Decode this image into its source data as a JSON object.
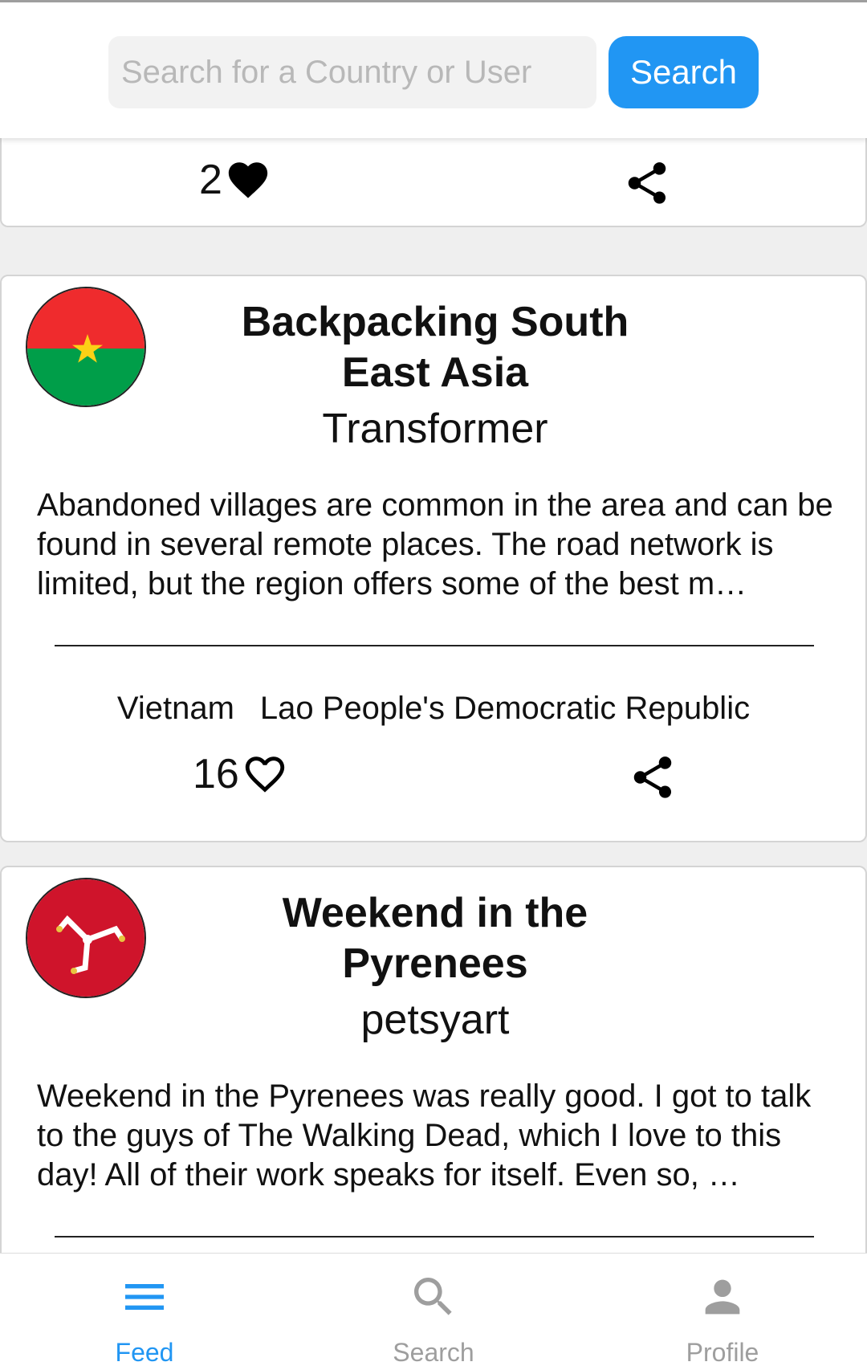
{
  "header": {
    "search_placeholder": "Search for a Country or User",
    "search_button": "Search"
  },
  "feed": {
    "partial_post": {
      "likes": "2",
      "liked": true
    },
    "posts": [
      {
        "flag": "burkina-faso-flag",
        "title_line1": "Backpacking South",
        "title_line2": "East Asia",
        "author": "Transformer",
        "body": "Abandoned villages are common in the area and can be found in several remote places. The road network is limited, but the region offers some of the best m…",
        "countries": [
          "Vietnam",
          "Lao People's Democratic Republic"
        ],
        "likes": "16",
        "liked": false
      },
      {
        "flag": "isle-of-man-flag",
        "title_line1": "Weekend in the",
        "title_line2": "Pyrenees",
        "author": "petsyart",
        "body": "Weekend in the Pyrenees was really good. I got to talk to the guys of The Walking Dead, which I love to this day! All of their work speaks for itself. Even so, …"
      }
    ]
  },
  "bottom_nav": {
    "items": [
      {
        "label": "Feed",
        "icon": "menu-icon",
        "active": true
      },
      {
        "label": "Search",
        "icon": "search-icon",
        "active": false
      },
      {
        "label": "Profile",
        "icon": "person-icon",
        "active": false
      }
    ]
  },
  "colors": {
    "accent": "#2196f3",
    "inactive": "#9e9e9e",
    "burkina_red": "#ef2b2d",
    "burkina_green": "#009e49",
    "burkina_star": "#fcd116",
    "isle_of_man_red": "#cf142b"
  }
}
